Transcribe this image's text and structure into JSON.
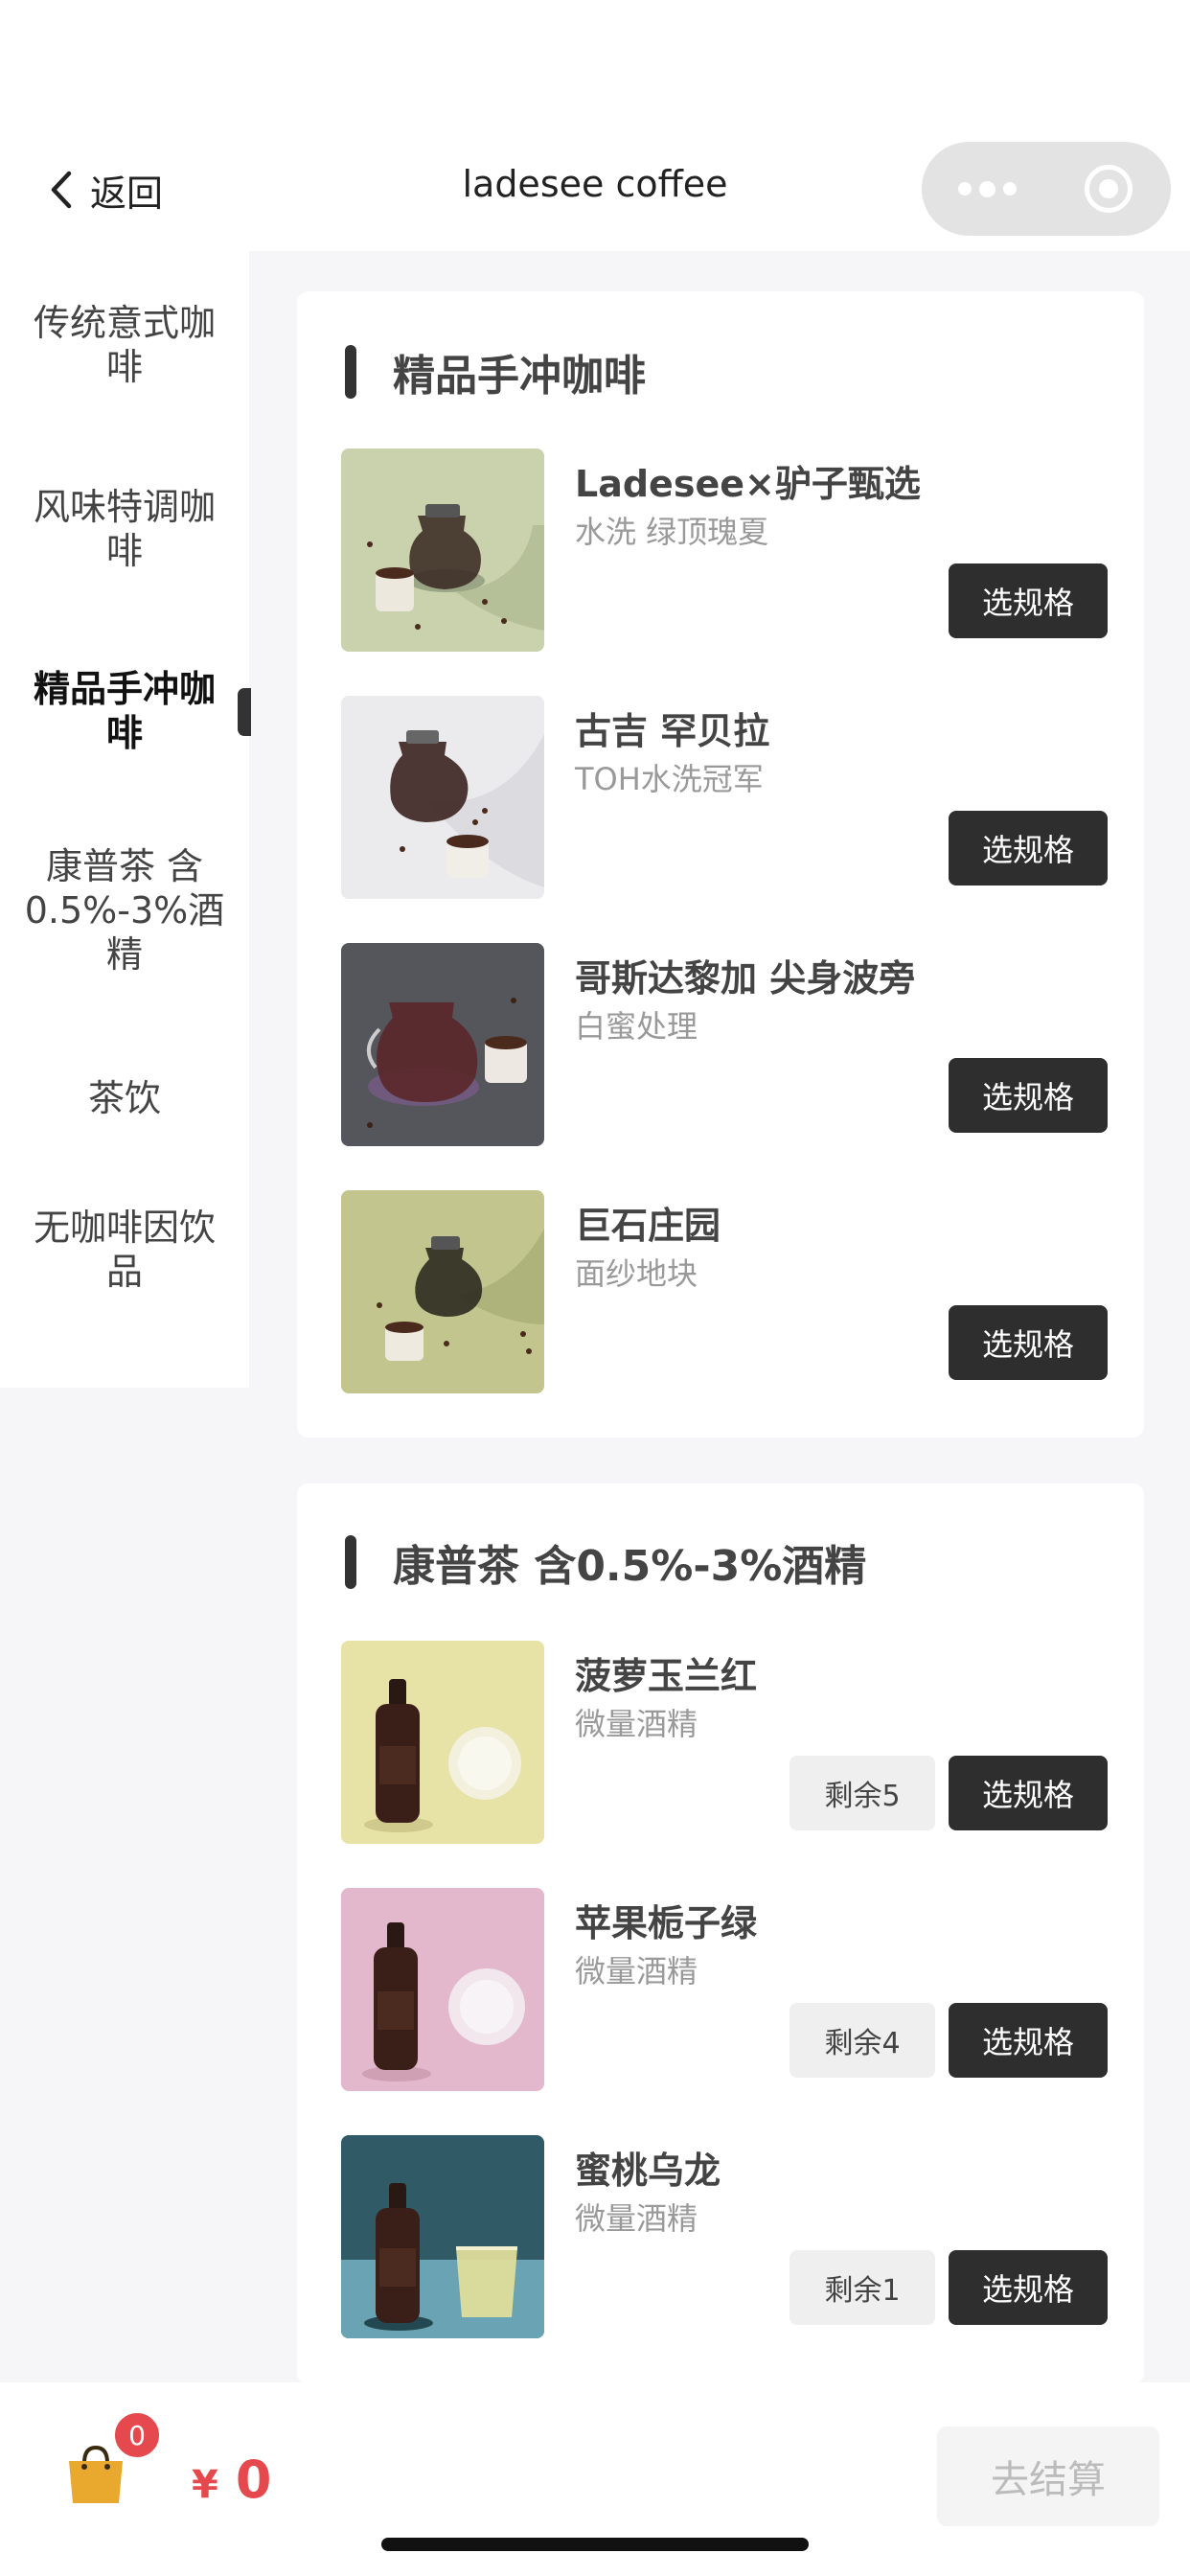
{
  "nav": {
    "back_label": "返回",
    "title": "ladesee coffee"
  },
  "sidebar": {
    "items": [
      {
        "label": "传统意式咖啡"
      },
      {
        "label": "风味特调咖啡"
      },
      {
        "label": "精品手冲咖啡",
        "active": true
      },
      {
        "label": "康普茶 含0.5%-3%酒精"
      },
      {
        "label": "茶饮"
      },
      {
        "label": "无咖啡因饮品"
      }
    ]
  },
  "sections": [
    {
      "title": "精品手冲咖啡",
      "items": [
        {
          "name": "Ladesee×驴子甄选",
          "desc": "水洗 绿顶瑰夏",
          "button": "选规格",
          "image": "pourover-on-sage"
        },
        {
          "name": "古吉 罕贝拉",
          "desc": "TOH水洗冠军",
          "button": "选规格",
          "image": "pourover-on-white"
        },
        {
          "name": "哥斯达黎加 尖身波旁",
          "desc": "白蜜处理",
          "button": "选规格",
          "image": "pourover-on-gray"
        },
        {
          "name": "巨石庄园",
          "desc": "面纱地块",
          "button": "选规格",
          "image": "pourover-on-olive"
        }
      ]
    },
    {
      "title": "康普茶 含0.5%-3%酒精",
      "items": [
        {
          "name": "菠萝玉兰红",
          "desc": "微量酒精",
          "stock": "剩余5",
          "button": "选规格",
          "image": "bottle-on-yellow"
        },
        {
          "name": "苹果栀子绿",
          "desc": "微量酒精",
          "stock": "剩余4",
          "button": "选规格",
          "image": "bottle-on-pink"
        },
        {
          "name": "蜜桃乌龙",
          "desc": "微量酒精",
          "stock": "剩余1",
          "button": "选规格",
          "image": "bottle-on-teal"
        }
      ]
    }
  ],
  "cart": {
    "badge_count": "0",
    "currency": "¥",
    "total": "0",
    "checkout_label": "去结算"
  },
  "colors": {
    "accent_red": "#e5484d",
    "button_dark": "#2e2e2e",
    "page_bg": "#f6f6f8"
  }
}
